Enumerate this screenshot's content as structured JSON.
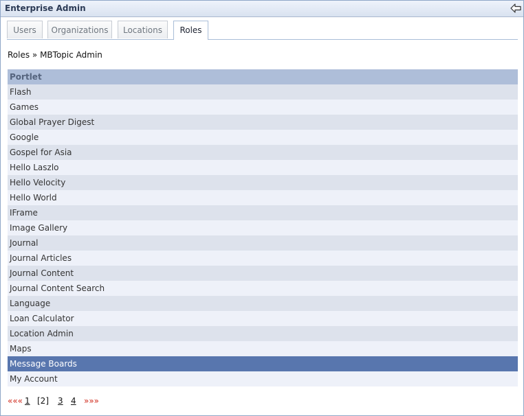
{
  "window": {
    "title": "Enterprise Admin"
  },
  "tabs": [
    {
      "label": "Users"
    },
    {
      "label": "Organizations"
    },
    {
      "label": "Locations"
    },
    {
      "label": "Roles",
      "active": true
    }
  ],
  "breadcrumb": "Roles » MBTopic Admin",
  "table": {
    "header": "Portlet",
    "rows": [
      "Flash",
      "Games",
      "Global Prayer Digest",
      "Google",
      "Gospel for Asia",
      "Hello Laszlo",
      "Hello Velocity",
      "Hello World",
      "IFrame",
      "Image Gallery",
      "Journal",
      "Journal Articles",
      "Journal Content",
      "Journal Content Search",
      "Language",
      "Loan Calculator",
      "Location Admin",
      "Maps",
      "Message Boards",
      "My Account"
    ],
    "selected_row": "Message Boards"
  },
  "pagination": {
    "first": "«««",
    "pages": [
      "1",
      "[2]",
      "3",
      "4"
    ],
    "current": "[2]",
    "last": "»»»"
  },
  "colors": {
    "header_bg": "#aebed9",
    "row_odd": "#dde2ec",
    "row_even": "#eef1f9",
    "selected": "#5876ae",
    "pager_arrow": "#d02a1c"
  }
}
